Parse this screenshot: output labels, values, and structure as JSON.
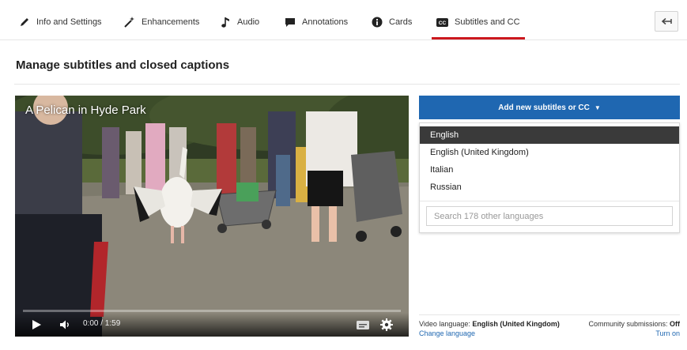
{
  "tabs": [
    {
      "label": "Info and Settings",
      "icon": "pencil-icon"
    },
    {
      "label": "Enhancements",
      "icon": "magic-wand-icon"
    },
    {
      "label": "Audio",
      "icon": "music-note-icon"
    },
    {
      "label": "Annotations",
      "icon": "speech-bubble-icon"
    },
    {
      "label": "Cards",
      "icon": "info-icon"
    },
    {
      "label": "Subtitles and CC",
      "icon": "cc-icon",
      "active": true
    }
  ],
  "back_icon": "back-arrow-icon",
  "page": {
    "title": "Manage subtitles and closed captions"
  },
  "video": {
    "title": "A Pelican in Hyde Park",
    "time": "0:00 / 1:59",
    "progress": 0
  },
  "add_button": {
    "label": "Add new subtitles or CC"
  },
  "languages": [
    {
      "label": "English",
      "selected": true
    },
    {
      "label": "English (United Kingdom)"
    },
    {
      "label": "Italian"
    },
    {
      "label": "Russian"
    }
  ],
  "search": {
    "placeholder": "Search 178 other languages"
  },
  "footer": {
    "video_language_label": "Video language:",
    "video_language_value": "English (United Kingdom)",
    "change_language": "Change language",
    "community_label": "Community submissions:",
    "community_value": "Off",
    "turn_on": "Turn on"
  },
  "colors": {
    "accent": "#1f67b1",
    "tab_active": "#cc181e"
  }
}
